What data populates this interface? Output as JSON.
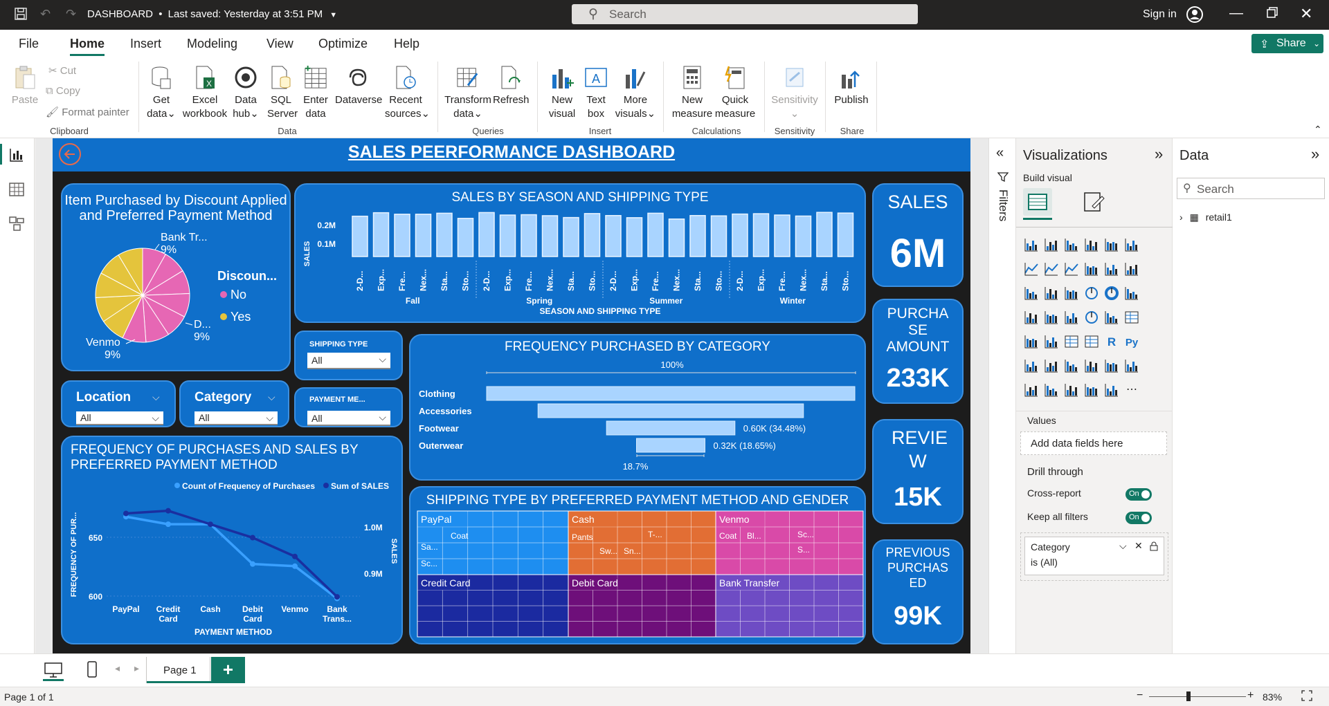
{
  "titlebar": {
    "doc_name": "DASHBOARD",
    "saved": "Last saved: Yesterday at 3:51 PM",
    "search_placeholder": "Search",
    "sign_in": "Sign in"
  },
  "menu": {
    "items": [
      "File",
      "Home",
      "Insert",
      "Modeling",
      "View",
      "Optimize",
      "Help"
    ],
    "active": "Home",
    "share": "Share"
  },
  "ribbon": {
    "clipboard": {
      "paste": "Paste",
      "cut": "Cut",
      "copy": "Copy",
      "format_painter": "Format painter",
      "group": "Clipboard"
    },
    "data": {
      "get_data": [
        "Get",
        "data"
      ],
      "excel": [
        "Excel",
        "workbook"
      ],
      "data_hub": [
        "Data",
        "hub"
      ],
      "sql": [
        "SQL",
        "Server"
      ],
      "enter": [
        "Enter",
        "data"
      ],
      "dataverse": [
        "Dataverse",
        ""
      ],
      "recent": [
        "Recent",
        "sources"
      ],
      "group": "Data"
    },
    "queries": {
      "transform": [
        "Transform",
        "data"
      ],
      "refresh": [
        "Refresh",
        ""
      ],
      "group": "Queries"
    },
    "insert": {
      "new_visual": [
        "New",
        "visual"
      ],
      "text_box": [
        "Text",
        "box"
      ],
      "more_visuals": [
        "More",
        "visuals"
      ],
      "group": "Insert"
    },
    "calculations": {
      "new_measure": [
        "New",
        "measure"
      ],
      "quick_measure": [
        "Quick",
        "measure"
      ],
      "group": "Calculations"
    },
    "sensitivity": {
      "label": "Sensitivity",
      "group": "Sensitivity"
    },
    "share": {
      "publish": "Publish",
      "group": "Share"
    }
  },
  "dashboard": {
    "title": "SALES PEERFORMANCE DASHBOARD",
    "pie": {
      "title_line1": "Item Purchased by Discount Applied",
      "title_line2": "and Preferred Payment Method",
      "legend_title": "Discoun...",
      "legend": [
        {
          "label": "No",
          "color": "#e667b4"
        },
        {
          "label": "Yes",
          "color": "#e4c43c"
        }
      ],
      "labels": [
        {
          "name": "Bank Tr...",
          "pct": "9%"
        },
        {
          "name": "D...",
          "pct": "9%"
        },
        {
          "name": "Venmo",
          "pct": "9%"
        }
      ]
    },
    "bars": {
      "title": "SALES BY SEASON AND SHIPPING TYPE",
      "ylabel": "SALES",
      "xlabel": "SEASON AND SHIPPING TYPE",
      "yticks": [
        "0.2M",
        "0.1M"
      ],
      "shipping_labels": [
        "2-D...",
        "Exp...",
        "Fre...",
        "Nex...",
        "Sta...",
        "Sto..."
      ],
      "seasons": [
        "Fall",
        "Spring",
        "Summer",
        "Winter"
      ]
    },
    "kpis": [
      {
        "title": "SALES",
        "value": "6M"
      },
      {
        "title": "PURCHA SE AMOUNT",
        "value": "233K"
      },
      {
        "title": "REVIE W",
        "value": "15K"
      },
      {
        "title": "PREVIOUS PURCHAS ED",
        "value": "99K"
      }
    ],
    "slicers": {
      "shipping": {
        "title": "SHIPPING TYPE",
        "value": "All"
      },
      "payment": {
        "title": "PAYMENT ME...",
        "value": "All"
      },
      "location": {
        "title": "Location",
        "value": "All"
      },
      "category": {
        "title": "Category",
        "value": "All"
      }
    },
    "funnel": {
      "title": "FREQUENCY PURCHASED BY CATEGORY",
      "top_pct": "100%",
      "bottom_pct": "18.7%",
      "labels": [
        "0.60K (34.48%)",
        "0.32K (18.65%)"
      ]
    },
    "line": {
      "title_line1": "FREQUENCY OF PURCHASES AND SALES BY",
      "title_line2": "PREFERRED PAYMENT METHOD",
      "legend": [
        {
          "label": "Count of Frequency of Purchases",
          "color": "#3aa0ff"
        },
        {
          "label": "Sum of SALES",
          "color": "#1a2fa0"
        }
      ],
      "ylabel_left": "FREQUENCY OF PUR...",
      "ylabel_right": "SALES",
      "xlabel": "PAYMENT METHOD",
      "left_ticks": [
        "650",
        "600"
      ],
      "right_ticks": [
        "1.0M",
        "0.9M"
      ],
      "categories": [
        [
          "PayPal"
        ],
        [
          "Credit",
          "Card"
        ],
        [
          "Cash"
        ],
        [
          "Debit",
          "Card"
        ],
        [
          "Venmo"
        ],
        [
          "Bank",
          "Trans..."
        ]
      ]
    },
    "treemap": {
      "title": "SHIPPING TYPE BY PREFERRED PAYMENT METHOD AND GENDER",
      "groups": [
        {
          "name": "PayPal",
          "color": "#1e8ef0",
          "sub": [
            "Coat",
            "Sa...",
            "Sc..."
          ]
        },
        {
          "name": "Cash",
          "color": "#e26e34",
          "sub": [
            "Pants",
            "T-...",
            "Sw...",
            "Sn..."
          ]
        },
        {
          "name": "Venmo",
          "color": "#d94aa8",
          "sub": [
            "Coat",
            "Bl...",
            "Sc...",
            "S..."
          ]
        },
        {
          "name": "Credit Card",
          "color": "#1b2aa0",
          "sub": []
        },
        {
          "name": "Debit Card",
          "color": "#6e0f7a",
          "sub": []
        },
        {
          "name": "Bank Transfer",
          "color": "#6e4cc4",
          "sub": []
        }
      ]
    }
  },
  "chart_data": [
    {
      "type": "pie",
      "title": "Item Purchased by Discount Applied and Preferred Payment Method",
      "series": [
        {
          "name": "No",
          "slices": 7,
          "share": 0.57
        },
        {
          "name": "Yes",
          "slices": 5,
          "share": 0.43
        }
      ],
      "labels": [
        "Bank Tr... 9%",
        "D... 9%",
        "Venmo 9%"
      ]
    },
    {
      "type": "bar",
      "title": "SALES BY SEASON AND SHIPPING TYPE",
      "xlabel": "SEASON AND SHIPPING TYPE",
      "ylabel": "SALES",
      "ylim": [
        0,
        0.3
      ],
      "y_unit": "M",
      "categories": [
        "Fall 2-D...",
        "Fall Exp...",
        "Fall Fre...",
        "Fall Nex...",
        "Fall Sta...",
        "Fall Sto...",
        "Spring 2-D...",
        "Spring Exp...",
        "Spring Fre...",
        "Spring Nex...",
        "Spring Sta...",
        "Spring Sto...",
        "Summer 2-D...",
        "Summer Exp...",
        "Summer Fre...",
        "Summer Nex...",
        "Summer Sta...",
        "Summer Sto...",
        "Winter 2-D...",
        "Winter Exp...",
        "Winter Fre...",
        "Winter Nex...",
        "Winter Sta...",
        "Winter Sto..."
      ],
      "values": [
        0.243,
        0.264,
        0.255,
        0.255,
        0.261,
        0.23,
        0.265,
        0.25,
        0.252,
        0.246,
        0.235,
        0.259,
        0.247,
        0.234,
        0.261,
        0.226,
        0.247,
        0.245,
        0.256,
        0.258,
        0.25,
        0.244,
        0.266,
        0.262
      ]
    },
    {
      "type": "bar",
      "title": "FREQUENCY PURCHASED BY CATEGORY",
      "categories": [
        "Clothing",
        "Accessories",
        "Footwear",
        "Outerwear"
      ],
      "values": [
        1.72,
        1.24,
        0.6,
        0.32
      ],
      "value_unit": "K",
      "percent_of_first": [
        100,
        72.2,
        34.48,
        18.65
      ]
    },
    {
      "type": "line",
      "title": "FREQUENCY OF PURCHASES AND SALES BY PREFERRED PAYMENT METHOD",
      "xlabel": "PAYMENT METHOD",
      "categories": [
        "PayPal",
        "Credit Card",
        "Cash",
        "Debit Card",
        "Venmo",
        "Bank Trans..."
      ],
      "series": [
        {
          "name": "Count of Frequency of Purchases",
          "axis": "left",
          "values": [
            677,
            670,
            670,
            633,
            631,
            601
          ]
        },
        {
          "name": "Sum of SALES",
          "axis": "right",
          "values": [
            1.04,
            1.045,
            1.02,
            0.995,
            0.96,
            0.885
          ]
        }
      ],
      "ylim_left": [
        600,
        690
      ],
      "ylim_right": [
        0.88,
        1.06
      ]
    }
  ],
  "filters_label": "Filters",
  "viz_pane": {
    "title": "Visualizations",
    "build_visual": "Build visual",
    "values_label": "Values",
    "add_fields": "Add data fields here",
    "drill_through": "Drill through",
    "cross_report": "Cross-report",
    "keep_filters": "Keep all filters",
    "toggle_on": "On",
    "filter_card_title": "Category",
    "filter_card_value": "is (All)"
  },
  "data_pane": {
    "title": "Data",
    "search_placeholder": "Search",
    "table": "retail1"
  },
  "pagebar": {
    "page_tab": "Page 1",
    "add": "+"
  },
  "status": {
    "page": "Page 1 of 1",
    "zoom": "83%"
  }
}
